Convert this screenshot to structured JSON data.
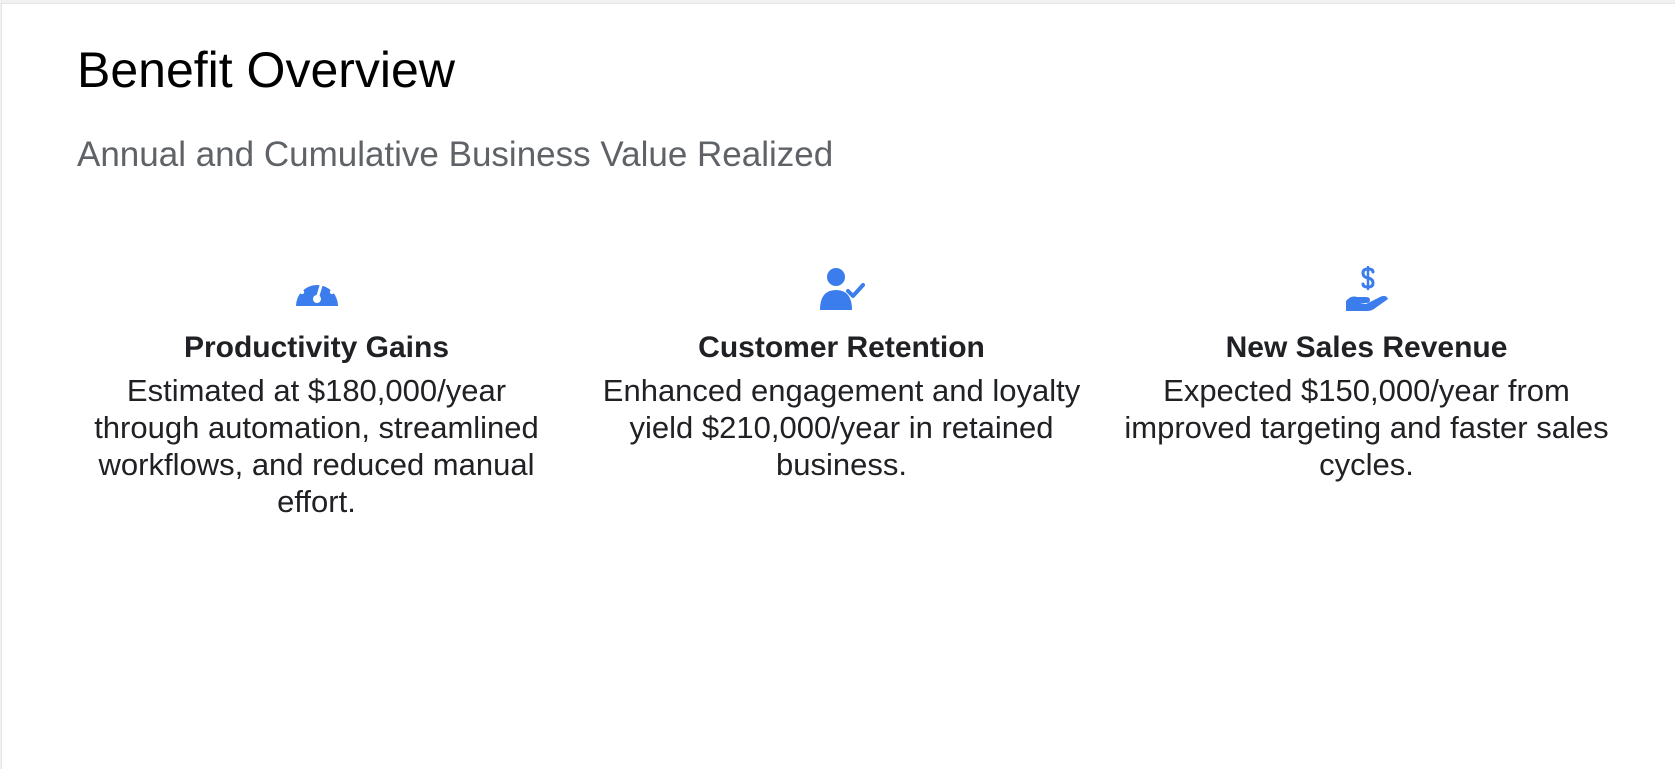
{
  "slide": {
    "title": "Benefit Overview",
    "subtitle": "Annual and Cumulative Business Value Realized"
  },
  "accent_color": "#3b7ded",
  "cards": [
    {
      "icon": "speedometer-icon",
      "title": "Productivity Gains",
      "text": "Estimated at $180,000/year through automation, streamlined workflows, and reduced manual effort."
    },
    {
      "icon": "user-check-icon",
      "title": "Customer Retention",
      "text": "Enhanced engagement and loyalty yield $210,000/year in retained business."
    },
    {
      "icon": "hand-dollar-icon",
      "title": "New Sales Revenue",
      "text": "Expected $150,000/year from improved targeting and faster sales cycles."
    }
  ]
}
